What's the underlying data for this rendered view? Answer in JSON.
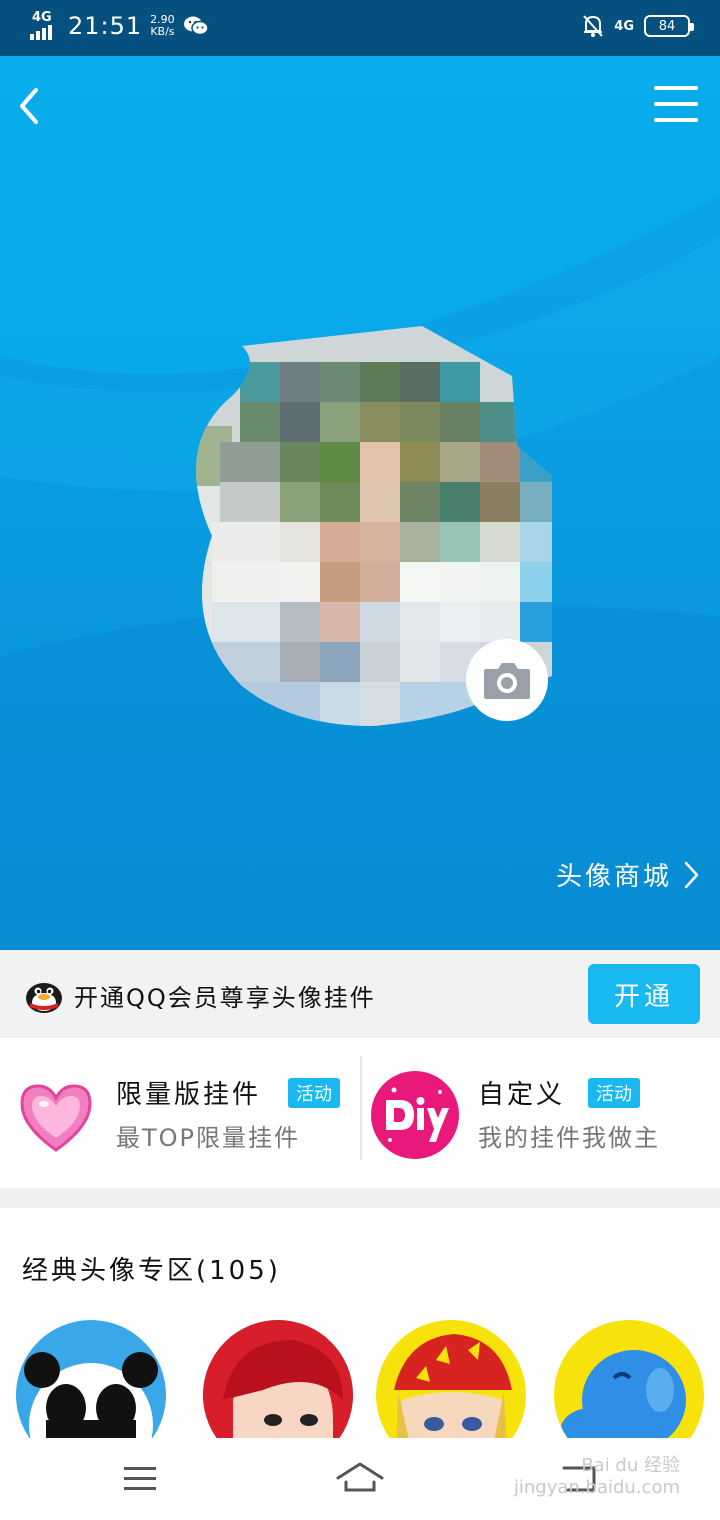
{
  "status_bar": {
    "network_left": "4G",
    "time": "21:51",
    "speed_value": "2.90",
    "speed_unit": "KB/s",
    "network_right": "4G",
    "battery": "84"
  },
  "header": {
    "back_icon": "chevron-left-icon",
    "menu_icon": "hamburger-menu-icon"
  },
  "hero": {
    "mall_link": "头像商城",
    "camera_icon": "camera-icon"
  },
  "vip_banner": {
    "text": "开通QQ会员尊享头像挂件",
    "button": "开通"
  },
  "features": [
    {
      "title": "限量版挂件",
      "badge": "活动",
      "subtitle": "最TOP限量挂件",
      "icon": "heart-icon"
    },
    {
      "title": "自定义",
      "badge": "活动",
      "subtitle": "我的挂件我做主",
      "icon": "diy-icon"
    }
  ],
  "classic_section": {
    "title": "经典头像专区(105)"
  },
  "watermark": {
    "line1": "Bai du 经验",
    "line2": "jingyan.baidu.com"
  },
  "colors": {
    "status_bar": "#05507e",
    "hero_blue": "#0aa8e8",
    "accent": "#1ab8f0"
  }
}
